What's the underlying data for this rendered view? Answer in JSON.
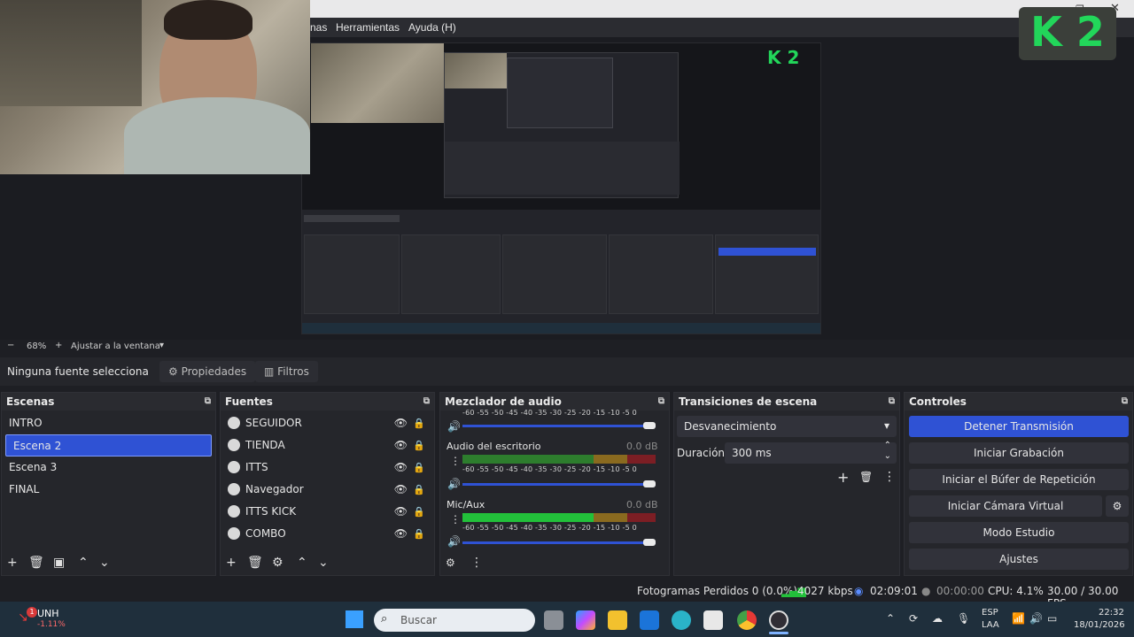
{
  "menu": {
    "items": [
      "nas",
      "Herramientas",
      "Ayuda (H)"
    ]
  },
  "watermark": {
    "logo": "K 2"
  },
  "zoom": {
    "minus": "−",
    "value": "68%",
    "plus": "+",
    "fit_label": "Ajustar a la ventana"
  },
  "source_toolbar": {
    "none_selected": "Ninguna fuente selecciona",
    "properties": "Propiedades",
    "filters": "Filtros"
  },
  "scenes": {
    "title": "Escenas",
    "items": [
      "INTRO",
      "Escena 2",
      "Escena 3",
      "FINAL"
    ],
    "selected": "Escena 2"
  },
  "sources": {
    "title": "Fuentes",
    "items": [
      "SEGUIDOR",
      "TIENDA",
      "ITTS",
      "Navegador",
      "ITTS KICK",
      "COMBO"
    ]
  },
  "mixer": {
    "title": "Mezclador de audio",
    "scale": "-60 -55 -50 -45 -40 -35 -30 -25 -20 -15 -10  -5   0",
    "channels": [
      {
        "name": "Audio del escritorio",
        "db": "0.0 dB",
        "level": 0.0
      },
      {
        "name": "Mic/Aux",
        "db": "0.0 dB",
        "level": 0.6
      }
    ]
  },
  "transitions": {
    "title": "Transiciones de escena",
    "selected": "Desvanecimiento",
    "duration_label": "Duración",
    "duration_value": "300 ms"
  },
  "controls": {
    "title": "Controles",
    "buttons": [
      "Detener Transmisión",
      "Iniciar Grabación",
      "Iniciar el Búfer de Repetición",
      "Iniciar Cámara Virtual",
      "Modo Estudio",
      "Ajustes"
    ]
  },
  "status": {
    "dropped": "Fotogramas Perdidos 0 (0.0%)",
    "bitrate": "4027 kbps",
    "stream_time": "02:09:01",
    "rec_time": "00:00:00",
    "cpu": "CPU: 4.1%",
    "fps": "30.00 / 30.00 FPS"
  },
  "taskbar": {
    "stock_name": "UNH",
    "stock_change": "-1.11%",
    "stock_badge": "1",
    "search_placeholder": "Buscar",
    "lang_line1": "ESP",
    "lang_line2": "LAA",
    "time": "22:32",
    "date": "18/01/2026"
  },
  "colors": {
    "accent": "#2f52d4",
    "dock_bg": "#25262b",
    "taskbar_bg": "#1f2f3c"
  }
}
